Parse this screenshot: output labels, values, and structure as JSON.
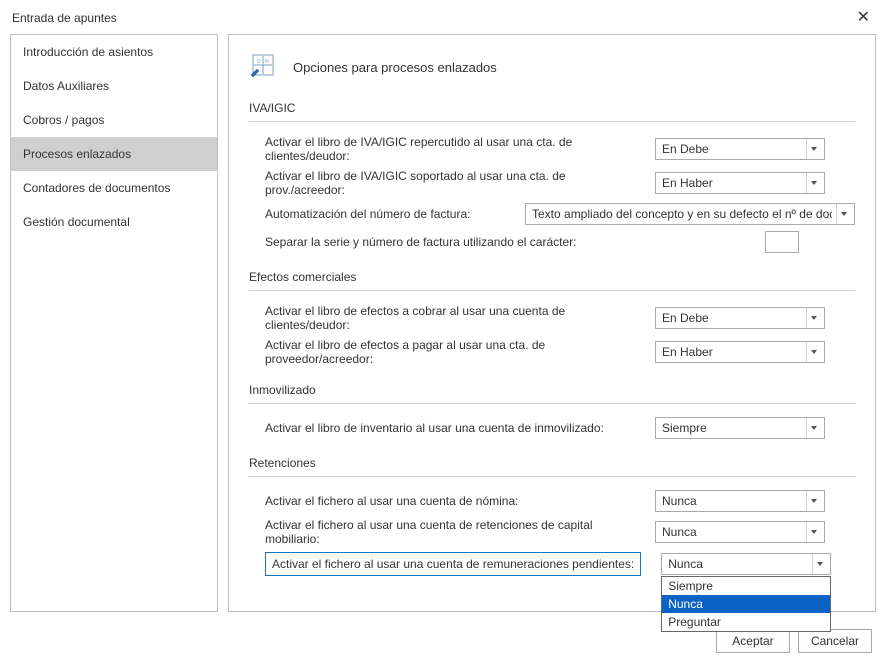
{
  "window": {
    "title": "Entrada de apuntes"
  },
  "sidebar": {
    "items": [
      {
        "label": "Introducción de asientos"
      },
      {
        "label": "Datos Auxiliares"
      },
      {
        "label": "Cobros / pagos"
      },
      {
        "label": "Procesos enlazados",
        "active": true
      },
      {
        "label": "Contadores de documentos"
      },
      {
        "label": "Gestión documental"
      }
    ]
  },
  "page": {
    "title": "Opciones para procesos enlazados"
  },
  "sections": {
    "iva": {
      "title": "IVA/IGIC",
      "row_repercutido": {
        "label": "Activar el libro de IVA/IGIC repercutido al usar una cta. de clientes/deudor:",
        "value": "En Debe"
      },
      "row_soportado": {
        "label": "Activar el libro de IVA/IGIC soportado al usar una cta. de prov./acreedor:",
        "value": "En Haber"
      },
      "row_autonum": {
        "label": "Automatización del número de factura:",
        "value": "Texto ampliado del concepto y en su defecto el nº de docu"
      },
      "row_separar": {
        "label": "Separar la serie y número de factura utilizando el carácter:",
        "value": ""
      }
    },
    "efectos": {
      "title": "Efectos comerciales",
      "row_cobrar": {
        "label": "Activar el libro de efectos a cobrar al usar una cuenta de clientes/deudor:",
        "value": "En Debe"
      },
      "row_pagar": {
        "label": "Activar el libro de efectos a pagar al usar una cta. de proveedor/acreedor:",
        "value": "En Haber"
      }
    },
    "inmovilizado": {
      "title": "Inmovilizado",
      "row_inv": {
        "label": "Activar el libro de inventario al usar una cuenta de inmovilizado:",
        "value": "Siempre"
      }
    },
    "retenciones": {
      "title": "Retenciones",
      "row_nomina": {
        "label": "Activar el fichero al usar una cuenta de nómina:",
        "value": "Nunca"
      },
      "row_capital": {
        "label": "Activar el fichero al usar una cuenta de retenciones de capital mobiliario:",
        "value": "Nunca"
      },
      "row_remun": {
        "label": "Activar el fichero al usar una cuenta de remuneraciones pendientes:",
        "value": "Nunca"
      }
    }
  },
  "dropdown_options": [
    "Siempre",
    "Nunca",
    "Preguntar"
  ],
  "dropdown_selected": "Nunca",
  "buttons": {
    "ok": "Aceptar",
    "cancel": "Cancelar"
  }
}
